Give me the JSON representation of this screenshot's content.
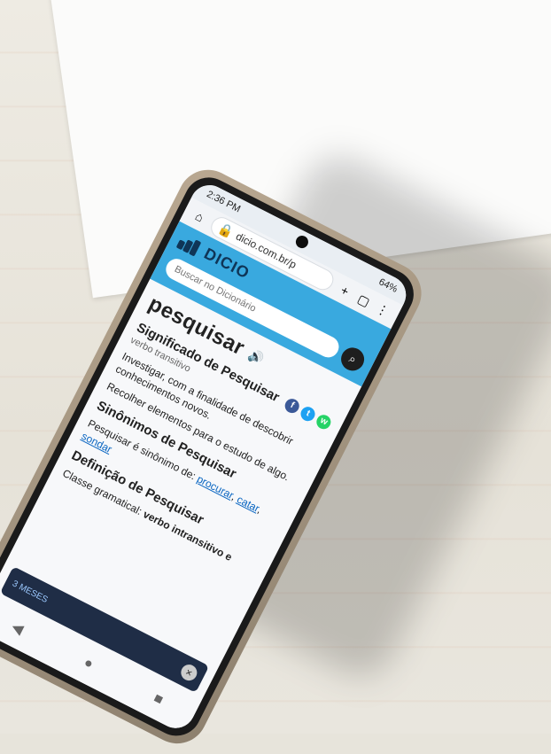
{
  "status": {
    "time": "2:36 PM",
    "battery": "64%"
  },
  "browser": {
    "url": "dicio.com.br/p"
  },
  "header": {
    "brand": "DICIO",
    "search_placeholder": "Buscar no Dicionário"
  },
  "entry": {
    "word": "pesquisar",
    "meaning_heading": "Significado de Pesquisar",
    "meaning_pos": "verbo transitivo",
    "meaning_1": "Investigar, com a finalidade de descobrir conhecimentos novos.",
    "meaning_2": "Recolher elementos para o estudo de algo.",
    "synonyms_heading": "Sinônimos de Pesquisar",
    "synonyms_text": "Pesquisar é sinônimo de:",
    "synonyms_links": [
      "procurar",
      "catar",
      "sondar"
    ],
    "definition_heading": "Definição de Pesquisar",
    "definition_text_prefix": "Classe gramatical:",
    "definition_text_bold": "verbo intransitivo e"
  },
  "ad": {
    "label": "3 MESES"
  },
  "icons": {
    "share": [
      "facebook-icon",
      "twitter-icon",
      "whatsapp-icon"
    ]
  }
}
